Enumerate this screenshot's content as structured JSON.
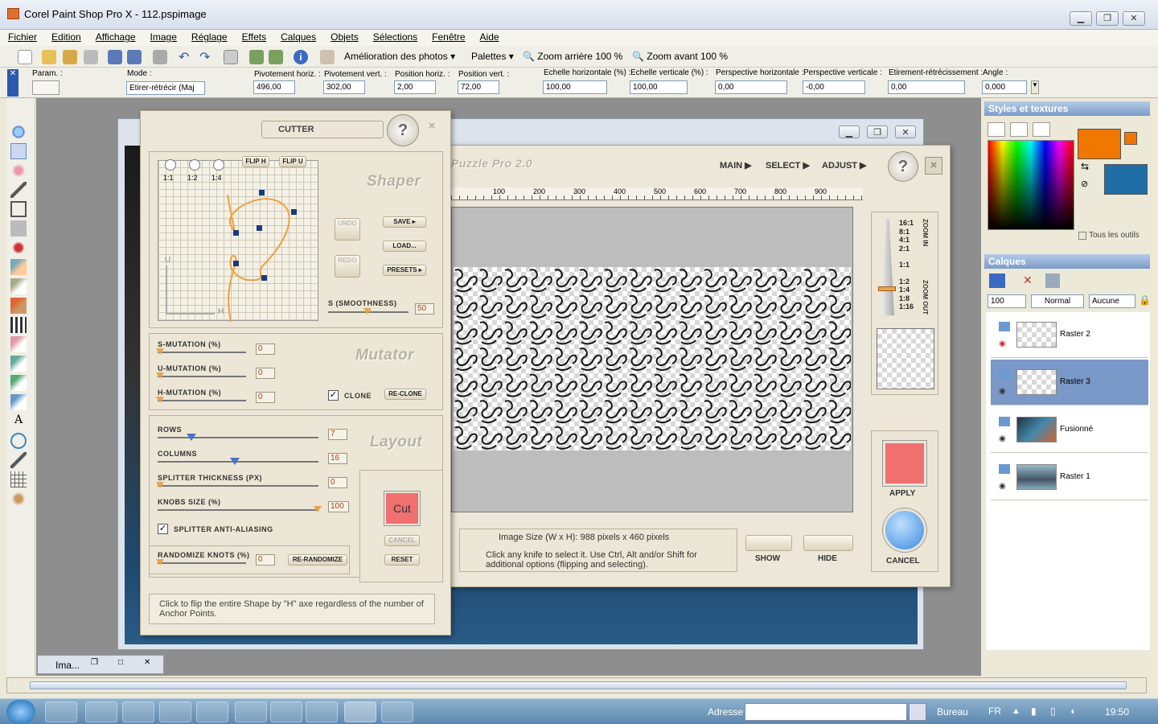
{
  "window": {
    "title": "Corel Paint Shop Pro X - 112.pspimage"
  },
  "menu": [
    "Fichier",
    "Edition",
    "Affichage",
    "Image",
    "Réglage",
    "Effets",
    "Calques",
    "Objets",
    "Sélections",
    "Fenêtre",
    "Aide"
  ],
  "toolbar": {
    "photo_enhance": "Amélioration des photos",
    "palettes": "Palettes",
    "zoom_out": "Zoom arrière 100 %",
    "zoom_in": "Zoom avant 100 %"
  },
  "tool_options": {
    "param_label": "Param. :",
    "mode_label": "Mode :",
    "mode_value": "Etirer-rétrécir (Maj",
    "fields": [
      {
        "label": "Pivotement horiz. :",
        "value": "496,00"
      },
      {
        "label": "Pivotement vert. :",
        "value": "302,00"
      },
      {
        "label": "Position horiz. :",
        "value": "2,00"
      },
      {
        "label": "Position vert. :",
        "value": "72,00"
      },
      {
        "label": "Echelle horizontale (%) :",
        "value": "100,00"
      },
      {
        "label": "Echelle verticale (%) :",
        "value": "100,00"
      },
      {
        "label": "Perspective horizontale :",
        "value": "0,00"
      },
      {
        "label": "Perspective verticale :",
        "value": "-0,00"
      },
      {
        "label": "Etirement-rétrécissement :",
        "value": "0,00"
      },
      {
        "label": "Angle :",
        "value": "0,000"
      }
    ]
  },
  "cutter": {
    "title": "CUTTER",
    "ratios": [
      "1:1",
      "1:2",
      "1:4"
    ],
    "flip_h": "FLIP H",
    "flip_u": "FLIP U",
    "shaper_title": "Shaper",
    "undo": "UNDO",
    "redo": "REDO",
    "save": "SAVE ▸",
    "load": "LOAD...",
    "presets": "PRESETS ▸",
    "axis_u": "U",
    "axis_h": "H",
    "smoothness_label": "S (SMOOTHNESS)",
    "smoothness_value": "50",
    "mutator_title": "Mutator",
    "s_mutation_label": "S-MUTATION (%)",
    "s_mutation_value": "0",
    "u_mutation_label": "U-MUTATION (%)",
    "u_mutation_value": "0",
    "h_mutation_label": "H-MUTATION (%)",
    "h_mutation_value": "0",
    "clone": "CLONE",
    "reclone": "RE-CLONE",
    "layout_title": "Layout",
    "rows_label": "ROWS",
    "rows_value": "7",
    "columns_label": "COLUMNS",
    "columns_value": "16",
    "splitter_label": "SPLITTER THICKNESS (PX)",
    "splitter_value": "0",
    "knobs_label": "KNOBS SIZE (%)",
    "knobs_value": "100",
    "antialias": "SPLITTER ANTI-ALIASING",
    "randomize_label": "RANDOMIZE KNOTS (%)",
    "randomize_value": "0",
    "rerandomize": "RE-RANDOMIZE",
    "cut": "Cut",
    "cancel": "CANCEL",
    "reset": "RESET",
    "hint": "Click to flip the entire Shape by \"H\" axe regardless of the number of Anchor Points."
  },
  "jigsaw": {
    "title": "Puzzle Pro 2.0",
    "nav": [
      "MAIN ▶",
      "SELECT ▶",
      "ADJUST ▶"
    ],
    "ruler": [
      "100",
      "200",
      "300",
      "400",
      "500",
      "600",
      "700",
      "800",
      "900"
    ],
    "zoom_levels": [
      "16:1",
      "8:1",
      "4:1",
      "2:1",
      "1:1",
      "1:2",
      "1:4",
      "1:8",
      "1:16"
    ],
    "zoom_in": "ZOOM IN",
    "zoom_out": "ZOOM OUT",
    "image_size": "Image Size (W x H): 988 pixels x 460 pixels",
    "hint": "Click any knife to select it. Use Ctrl, Alt and/or Shift for additional options (flipping and selecting).",
    "show": "SHOW",
    "hide": "HIDE",
    "apply": "APPLY",
    "cancel": "CANCEL"
  },
  "minimized_doc": "Ima...",
  "styles_panel": {
    "title": "Styles et textures",
    "all_tools": "Tous les outils"
  },
  "layers_panel": {
    "title": "Calques",
    "opacity": "100",
    "blend": "Normal",
    "mask": "Aucune",
    "layers": [
      {
        "name": "Raster 2",
        "selected": false
      },
      {
        "name": "Raster 3",
        "selected": true
      },
      {
        "name": "Fusionné",
        "selected": false
      },
      {
        "name": "Raster 1",
        "selected": false
      }
    ]
  },
  "taskbar": {
    "address_label": "Adresse",
    "desktop": "Bureau",
    "lang": "FR",
    "time": "19:50"
  },
  "colors": {
    "foreground": "#f07800",
    "background": "#1f6ea6",
    "selected_layer": "#7a98c8"
  }
}
